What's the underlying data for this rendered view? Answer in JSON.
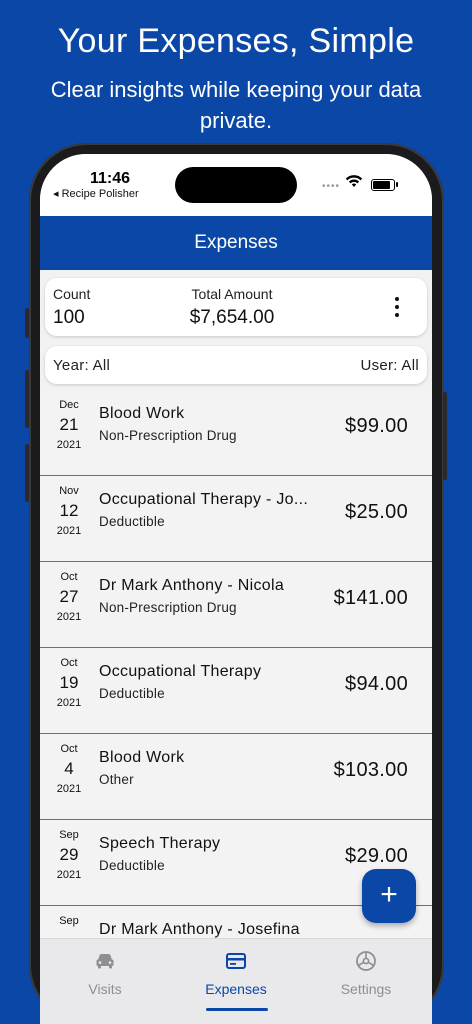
{
  "promo": {
    "title": "Your Expenses, Simple",
    "subtitle": "Clear insights while keeping your data private."
  },
  "status_bar": {
    "time": "11:46",
    "back_app": "◂ Recipe Polisher"
  },
  "app_bar": {
    "title": "Expenses"
  },
  "summary": {
    "count_label": "Count",
    "count_value": "100",
    "total_label": "Total Amount",
    "total_value": "$7,654.00"
  },
  "filters": {
    "year": "Year: All",
    "user": "User: All"
  },
  "expenses": [
    {
      "month": "Dec",
      "day": "21",
      "year": "2021",
      "title": "Blood Work",
      "category": "Non-Prescription Drug",
      "amount": "$99.00"
    },
    {
      "month": "Nov",
      "day": "12",
      "year": "2021",
      "title": "Occupational Therapy - Jo...",
      "category": "Deductible",
      "amount": "$25.00"
    },
    {
      "month": "Oct",
      "day": "27",
      "year": "2021",
      "title": "Dr Mark Anthony - Nicola",
      "category": "Non-Prescription Drug",
      "amount": "$141.00"
    },
    {
      "month": "Oct",
      "day": "19",
      "year": "2021",
      "title": "Occupational Therapy",
      "category": "Deductible",
      "amount": "$94.00"
    },
    {
      "month": "Oct",
      "day": "4",
      "year": "2021",
      "title": "Blood Work",
      "category": "Other",
      "amount": "$103.00"
    },
    {
      "month": "Sep",
      "day": "29",
      "year": "2021",
      "title": "Speech Therapy",
      "category": "Deductible",
      "amount": "$29.00"
    },
    {
      "month": "Sep",
      "day": "",
      "year": "",
      "title": "Dr Mark Anthony - Josefina",
      "category": "",
      "amount": ""
    }
  ],
  "fab": {
    "label": "+"
  },
  "tabs": [
    {
      "label": "Visits",
      "icon": "car-icon"
    },
    {
      "label": "Expenses",
      "icon": "credit-card-icon"
    },
    {
      "label": "Settings",
      "icon": "settings-icon"
    }
  ],
  "colors": {
    "brand": "#0a47a6",
    "tab_inactive": "#8e8e93"
  }
}
